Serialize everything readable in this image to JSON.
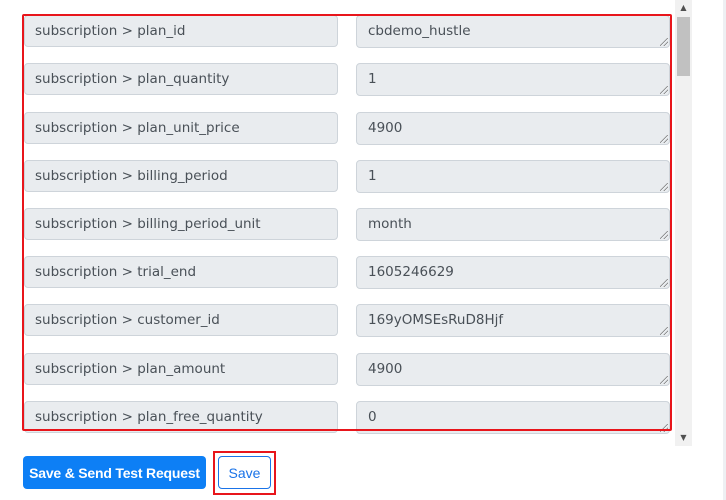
{
  "mapping": {
    "rows": [
      {
        "label": "",
        "value": ""
      },
      {
        "label": "subscription > plan_id",
        "value": "cbdemo_hustle"
      },
      {
        "label": "subscription > plan_quantity",
        "value": "1"
      },
      {
        "label": "subscription > plan_unit_price",
        "value": "4900"
      },
      {
        "label": "subscription > billing_period",
        "value": "1"
      },
      {
        "label": "subscription > billing_period_unit",
        "value": "month"
      },
      {
        "label": "subscription > trial_end",
        "value": "1605246629"
      },
      {
        "label": "subscription > customer_id",
        "value": "169yOMSEsRuD8Hjf"
      },
      {
        "label": "subscription > plan_amount",
        "value": "4900"
      },
      {
        "label": "subscription > plan_free_quantity",
        "value": "0"
      }
    ]
  },
  "scrollbar": {
    "up_icon": "▲",
    "down_icon": "▼",
    "position_fraction": 0.0
  },
  "actions": {
    "save_send_label": "Save & Send Test Request",
    "save_label": "Save"
  },
  "colors": {
    "highlight": "#e8151b",
    "primary": "#0d7ff5",
    "field_bg": "#e9ecef"
  }
}
